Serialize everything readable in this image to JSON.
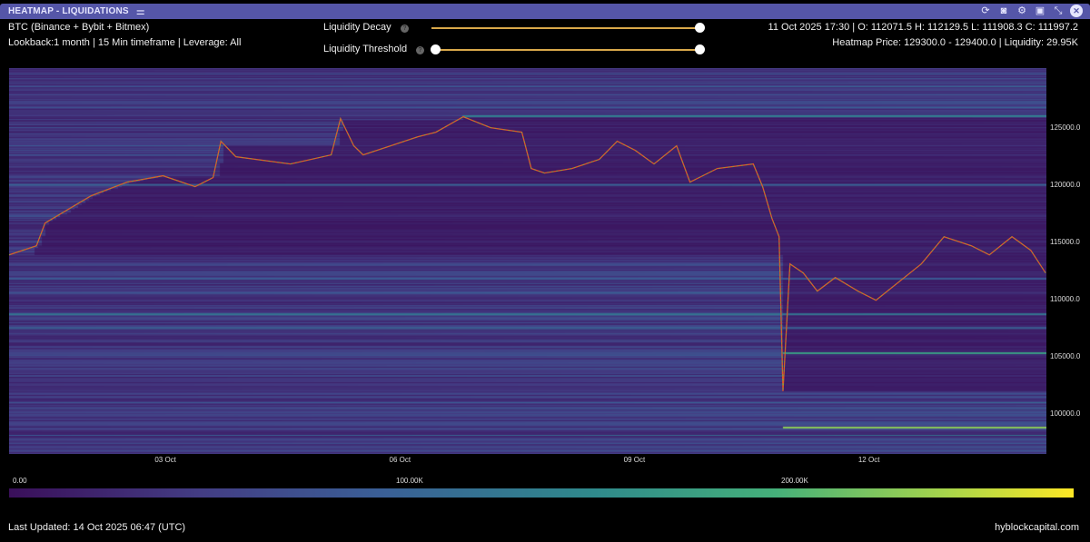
{
  "window": {
    "title": "HEATMAP - LIQUIDATIONS",
    "icons": [
      "refresh-icon",
      "camera-icon",
      "gear-icon",
      "save-icon",
      "expand-icon",
      "close-icon"
    ]
  },
  "header": {
    "symbol": "BTC (Binance + Bybit + Bitmex)",
    "settings": "Lookback:1 month | 15 Min timeframe | Leverage: All",
    "ohlc": "11 Oct 2025 17:30 | O: 112071.5 H: 112129.5 L: 111908.3 C: 111997.2",
    "hover": "Heatmap Price: 129300.0 - 129400.0 | Liquidity: 29.95K"
  },
  "controls": {
    "decay_label": "Liquidity Decay",
    "decay_value": 1.0,
    "threshold_label": "Liquidity Threshold",
    "threshold_range": [
      0.0,
      1.0
    ],
    "slider_color": "#d9a84a"
  },
  "chart_data": {
    "type": "heatmap",
    "title": "HEATMAP - LIQUIDATIONS",
    "x_unit": "days since 01 Oct 2025 00:00 UTC",
    "xlim": [
      0,
      13.27
    ],
    "ylim": [
      96500,
      130200
    ],
    "xticks": [
      {
        "label": "03 Oct",
        "value": 2
      },
      {
        "label": "06 Oct",
        "value": 5
      },
      {
        "label": "09 Oct",
        "value": 8
      },
      {
        "label": "12 Oct",
        "value": 11
      }
    ],
    "yticks": [
      {
        "label": "125000.0",
        "value": 125000
      },
      {
        "label": "120000.0",
        "value": 120000
      },
      {
        "label": "115000.0",
        "value": 115000
      },
      {
        "label": "110000.0",
        "value": 110000
      },
      {
        "label": "105000.0",
        "value": 105000
      },
      {
        "label": "100000.0",
        "value": 100000
      }
    ],
    "price_series": {
      "name": "BTC price",
      "color": "#e0552a",
      "x": [
        0,
        0.35,
        0.46,
        1.05,
        1.51,
        1.97,
        2.38,
        2.61,
        2.71,
        2.9,
        3.6,
        4.12,
        4.24,
        4.41,
        4.53,
        4.88,
        5.23,
        5.46,
        5.81,
        6.16,
        6.56,
        6.68,
        6.85,
        7.2,
        7.55,
        7.78,
        8.01,
        8.25,
        8.54,
        8.71,
        9.06,
        9.52,
        9.64,
        9.76,
        9.85,
        9.9,
        9.99,
        10.16,
        10.34,
        10.57,
        10.86,
        11.09,
        11.38,
        11.67,
        11.96,
        12.31,
        12.54,
        12.83,
        13.07,
        13.26
      ],
      "y": [
        113889,
        114683,
        116667,
        119048,
        120238,
        120794,
        119841,
        120635,
        123810,
        122460,
        121825,
        122619,
        125794,
        123413,
        122619,
        123413,
        124206,
        124603,
        125952,
        125000,
        124603,
        121429,
        121032,
        121429,
        122222,
        123810,
        123016,
        121825,
        123413,
        120238,
        121429,
        121825,
        119841,
        117063,
        115476,
        101984,
        113095,
        112302,
        110714,
        111905,
        110714,
        109921,
        111508,
        113095,
        115476,
        114683,
        113889,
        115476,
        114286,
        112302
      ]
    },
    "notable_levels": [
      {
        "price": 98800,
        "from": 9.9,
        "liquidity": 200000
      },
      {
        "price": 105300,
        "from": 9.9,
        "liquidity": 150000
      },
      {
        "price": 108700,
        "from": 0,
        "liquidity": 110000
      },
      {
        "price": 107500,
        "from": 0,
        "liquidity": 90000
      },
      {
        "price": 126000,
        "from": 5.8,
        "liquidity": 120000
      },
      {
        "price": 120000,
        "from": 0,
        "liquidity": 90000
      },
      {
        "price": 111800,
        "from": 0,
        "liquidity": 80000
      }
    ],
    "colorbar": {
      "min_label": "0.00",
      "mid_label": "100.00K",
      "high_label": "200.00K",
      "range": [
        0,
        240000
      ]
    }
  },
  "footer": {
    "updated": "Last Updated: 14 Oct 2025 06:47 (UTC)",
    "brand": "hyblockcapital.com"
  }
}
